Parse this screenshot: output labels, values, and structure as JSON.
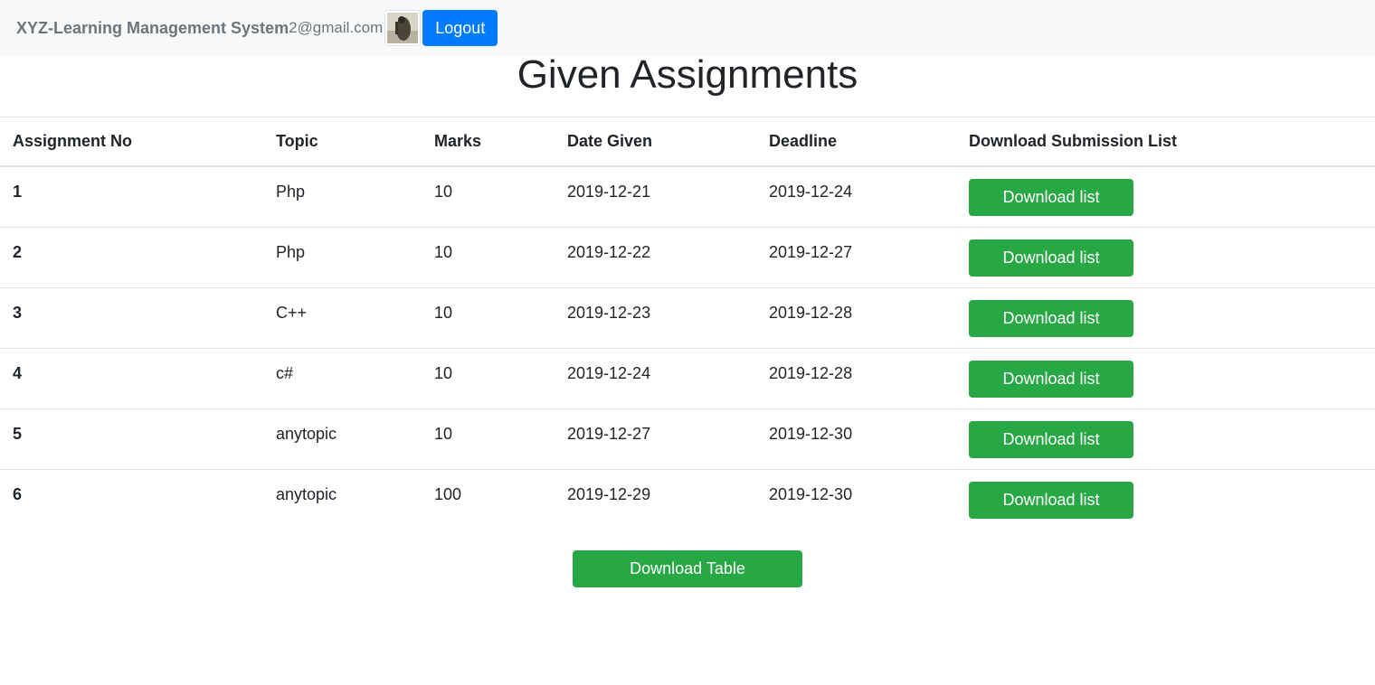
{
  "navbar": {
    "brand": "XYZ-Learning Management System",
    "email": "2@gmail.com",
    "avatar_icon": "user-avatar-photo",
    "logout_label": "Logout"
  },
  "page": {
    "title": "Given Assignments"
  },
  "table": {
    "headers": [
      "Assignment No",
      "Topic",
      "Marks",
      "Date Given",
      "Deadline",
      "Download Submission List"
    ],
    "rows": [
      {
        "no": "1",
        "topic": "Php",
        "marks": "10",
        "date_given": "2019-12-21",
        "deadline": "2019-12-24",
        "action": "Download list"
      },
      {
        "no": "2",
        "topic": "Php",
        "marks": "10",
        "date_given": "2019-12-22",
        "deadline": "2019-12-27",
        "action": "Download list"
      },
      {
        "no": "3",
        "topic": "C++",
        "marks": "10",
        "date_given": "2019-12-23",
        "deadline": "2019-12-28",
        "action": "Download list"
      },
      {
        "no": "4",
        "topic": "c#",
        "marks": "10",
        "date_given": "2019-12-24",
        "deadline": "2019-12-28",
        "action": "Download list"
      },
      {
        "no": "5",
        "topic": "anytopic",
        "marks": "10",
        "date_given": "2019-12-27",
        "deadline": "2019-12-30",
        "action": "Download list"
      },
      {
        "no": "6",
        "topic": "anytopic",
        "marks": "100",
        "date_given": "2019-12-29",
        "deadline": "2019-12-30",
        "action": "Download list"
      }
    ]
  },
  "footer": {
    "download_table_label": "Download Table"
  },
  "colors": {
    "navbar_bg": "#f8f9fa",
    "primary": "#007bff",
    "success": "#28a745",
    "muted_text": "#6c757d"
  }
}
